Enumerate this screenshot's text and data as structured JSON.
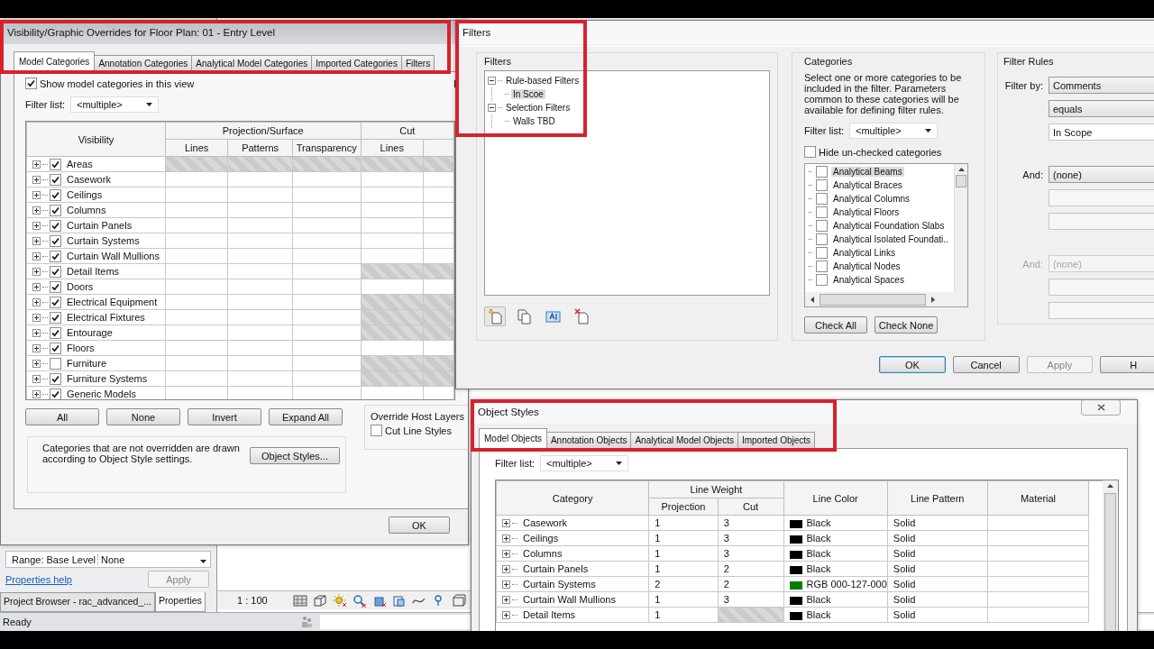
{
  "vg_dialog": {
    "title": "Visibility/Graphic Overrides for Floor Plan: 01 - Entry Level",
    "tabs": [
      {
        "label": "Model Categories",
        "selected": true
      },
      {
        "label": "Annotation Categories",
        "selected": false
      },
      {
        "label": "Analytical Model Categories",
        "selected": false
      },
      {
        "label": "Imported Categories",
        "selected": false
      },
      {
        "label": "Filters",
        "selected": false
      }
    ],
    "show_categories": {
      "label": "Show model categories in this view",
      "checked": true
    },
    "side_text": "I",
    "filter_list": {
      "label": "Filter list:",
      "value": "<multiple>"
    },
    "table": {
      "first_column": "Visibility",
      "groups": [
        {
          "label": "Projection/Surface",
          "columns": [
            "Lines",
            "Patterns",
            "Transparency"
          ]
        },
        {
          "label": "Cut",
          "columns": [
            "Lines"
          ]
        }
      ],
      "rows": [
        {
          "name": "Areas",
          "visible": true,
          "projection_hatched": true,
          "cut_hatched": true
        },
        {
          "name": "Casework",
          "visible": true,
          "projection_hatched": false,
          "cut_hatched": false
        },
        {
          "name": "Ceilings",
          "visible": true,
          "projection_hatched": false,
          "cut_hatched": false
        },
        {
          "name": "Columns",
          "visible": true,
          "projection_hatched": false,
          "cut_hatched": false
        },
        {
          "name": "Curtain Panels",
          "visible": true,
          "projection_hatched": false,
          "cut_hatched": false
        },
        {
          "name": "Curtain Systems",
          "visible": true,
          "projection_hatched": false,
          "cut_hatched": false
        },
        {
          "name": "Curtain Wall Mullions",
          "visible": true,
          "projection_hatched": false,
          "cut_hatched": false
        },
        {
          "name": "Detail Items",
          "visible": true,
          "projection_hatched": false,
          "cut_hatched": true
        },
        {
          "name": "Doors",
          "visible": true,
          "projection_hatched": false,
          "cut_hatched": false
        },
        {
          "name": "Electrical Equipment",
          "visible": true,
          "projection_hatched": false,
          "cut_hatched": true
        },
        {
          "name": "Electrical Fixtures",
          "visible": true,
          "projection_hatched": false,
          "cut_hatched": true
        },
        {
          "name": "Entourage",
          "visible": true,
          "projection_hatched": false,
          "cut_hatched": true
        },
        {
          "name": "Floors",
          "visible": true,
          "projection_hatched": false,
          "cut_hatched": false
        },
        {
          "name": "Furniture",
          "visible": false,
          "projection_hatched": false,
          "cut_hatched": true
        },
        {
          "name": "Furniture Systems",
          "visible": true,
          "projection_hatched": false,
          "cut_hatched": true
        },
        {
          "name": "Generic Models",
          "visible": true,
          "projection_hatched": false,
          "cut_hatched": false
        }
      ]
    },
    "buttons": [
      "All",
      "None",
      "Invert",
      "Expand All"
    ],
    "override_group": {
      "title": "Override Host Layers",
      "checkbox": {
        "label": "Cut Line Styles",
        "checked": false
      }
    },
    "note": "Categories that are not overridden are drawn according to Object Style settings.",
    "object_styles_button": "Object Styles...",
    "ok_button": "OK"
  },
  "properties_panel": {
    "row": {
      "label": "Range: Base Level",
      "value": "None"
    },
    "help_link": "Properties help",
    "apply_button": {
      "label": "Apply",
      "disabled": true
    },
    "tabs": [
      {
        "label": "Project Browser - rac_advanced_...",
        "selected": false
      },
      {
        "label": "Properties",
        "selected": true
      }
    ]
  },
  "view_bar": {
    "scale": "1 : 100"
  },
  "status_bar": {
    "text": "Ready"
  },
  "filters_dialog": {
    "title": "Filters",
    "filters_group": {
      "title": "Filters",
      "tree": [
        {
          "label": "Rule-based Filters",
          "expanded": true,
          "selected": false,
          "children": [
            {
              "label": "In Scoe",
              "selected": true
            }
          ]
        },
        {
          "label": "Selection Filters",
          "expanded": true,
          "selected": false,
          "children": [
            {
              "label": "Walls TBD",
              "selected": false
            }
          ]
        }
      ]
    },
    "categories_group": {
      "title": "Categories",
      "description": "Select one or more categories to be included in the filter.  Parameters common to these categories will be available for defining filter rules.",
      "filter_list": {
        "label": "Filter list:",
        "value": "<multiple>"
      },
      "hide_unchecked": {
        "label": "Hide un-checked categories",
        "checked": false
      },
      "items": [
        {
          "label": "Analytical Beams",
          "checked": false,
          "selected": true
        },
        {
          "label": "Analytical Braces",
          "checked": false,
          "selected": false
        },
        {
          "label": "Analytical Columns",
          "checked": false,
          "selected": false
        },
        {
          "label": "Analytical Floors",
          "checked": false,
          "selected": false
        },
        {
          "label": "Analytical Foundation Slabs",
          "checked": false,
          "selected": false
        },
        {
          "label": "Analytical Isolated Foundati..",
          "checked": false,
          "selected": false
        },
        {
          "label": "Analytical Links",
          "checked": false,
          "selected": false
        },
        {
          "label": "Analytical Nodes",
          "checked": false,
          "selected": false
        },
        {
          "label": "Analytical Spaces",
          "checked": false,
          "selected": false
        }
      ],
      "buttons": [
        "Check All",
        "Check None"
      ]
    },
    "rules_group": {
      "title": "Filter Rules",
      "filter_by": {
        "label": "Filter by:",
        "value": "Comments"
      },
      "operator": "equals",
      "value": "In Scope",
      "and_rows": [
        {
          "label": "And:",
          "value": "(none)",
          "disabled": false
        },
        {
          "label": "And:",
          "value": "(none)",
          "disabled": true
        }
      ]
    },
    "buttons": [
      {
        "label": "OK",
        "kind": "default"
      },
      {
        "label": "Cancel",
        "kind": "normal"
      },
      {
        "label": "Apply",
        "kind": "disabled"
      },
      {
        "label": "H",
        "kind": "normal"
      }
    ]
  },
  "object_styles": {
    "title": "Object Styles",
    "tabs": [
      {
        "label": "Model Objects",
        "selected": true
      },
      {
        "label": "Annotation Objects",
        "selected": false
      },
      {
        "label": "Analytical Model Objects",
        "selected": false
      },
      {
        "label": "Imported Objects",
        "selected": false
      }
    ],
    "filter_list": {
      "label": "Filter list:",
      "value": "<multiple>"
    },
    "columns": {
      "category": "Category",
      "line_weight": "Line Weight",
      "projection": "Projection",
      "cut": "Cut",
      "line_color": "Line Color",
      "line_pattern": "Line Pattern",
      "material": "Material"
    },
    "rows": [
      {
        "category": "Casework",
        "projection": "1",
        "cut": "3",
        "color_name": "Black",
        "color": "#000000",
        "pattern": "Solid"
      },
      {
        "category": "Ceilings",
        "projection": "1",
        "cut": "3",
        "color_name": "Black",
        "color": "#000000",
        "pattern": "Solid"
      },
      {
        "category": "Columns",
        "projection": "1",
        "cut": "3",
        "color_name": "Black",
        "color": "#000000",
        "pattern": "Solid"
      },
      {
        "category": "Curtain Panels",
        "projection": "1",
        "cut": "2",
        "color_name": "Black",
        "color": "#000000",
        "pattern": "Solid"
      },
      {
        "category": "Curtain Systems",
        "projection": "2",
        "cut": "2",
        "color_name": "RGB 000-127-000",
        "color": "#007f00",
        "pattern": "Solid"
      },
      {
        "category": "Curtain Wall Mullions",
        "projection": "1",
        "cut": "3",
        "color_name": "Black",
        "color": "#000000",
        "pattern": "Solid"
      },
      {
        "category": "Detail Items",
        "projection": "1",
        "cut_hatched": true,
        "color_name": "Black",
        "color": "#000000",
        "pattern": "Solid"
      }
    ]
  }
}
